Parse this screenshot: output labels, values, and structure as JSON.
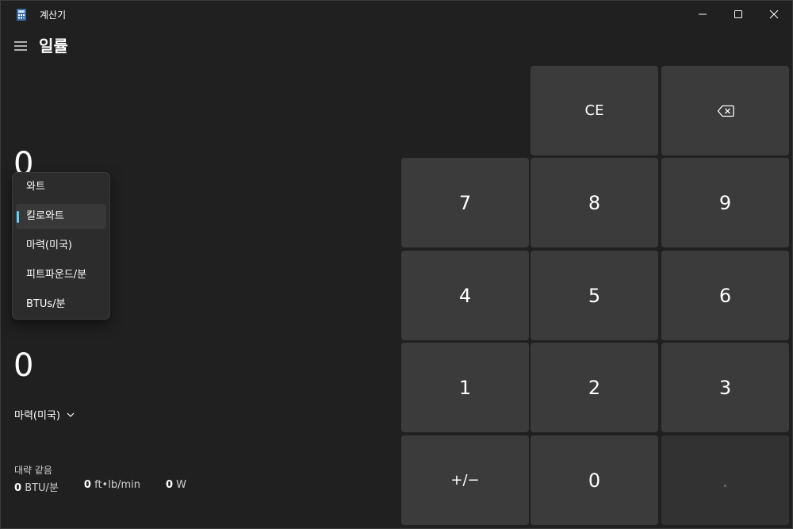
{
  "window": {
    "title": "계산기",
    "mode_title": "일률"
  },
  "converter": {
    "from_value": "0",
    "to_value": "0",
    "to_unit": "마력(미국)",
    "approx_label": "대략 같음",
    "approx": [
      {
        "value": "0",
        "unit": "BTU/분"
      },
      {
        "value": "0",
        "unit": "ft•lb/min"
      },
      {
        "value": "0",
        "unit": "W"
      }
    ]
  },
  "dropdown": {
    "items": [
      "와트",
      "킬로와트",
      "마력(미국)",
      "피트파운드/분",
      "BTUs/분"
    ],
    "selected": "킬로와트",
    "accent_color": "#60cdff"
  },
  "keypad": {
    "ce": "CE",
    "backspace_icon": "backspace-icon",
    "digits": {
      "0": "0",
      "1": "1",
      "2": "2",
      "3": "3",
      "4": "4",
      "5": "5",
      "6": "6",
      "7": "7",
      "8": "8",
      "9": "9"
    },
    "negate": "+/−",
    "decimal": "."
  }
}
